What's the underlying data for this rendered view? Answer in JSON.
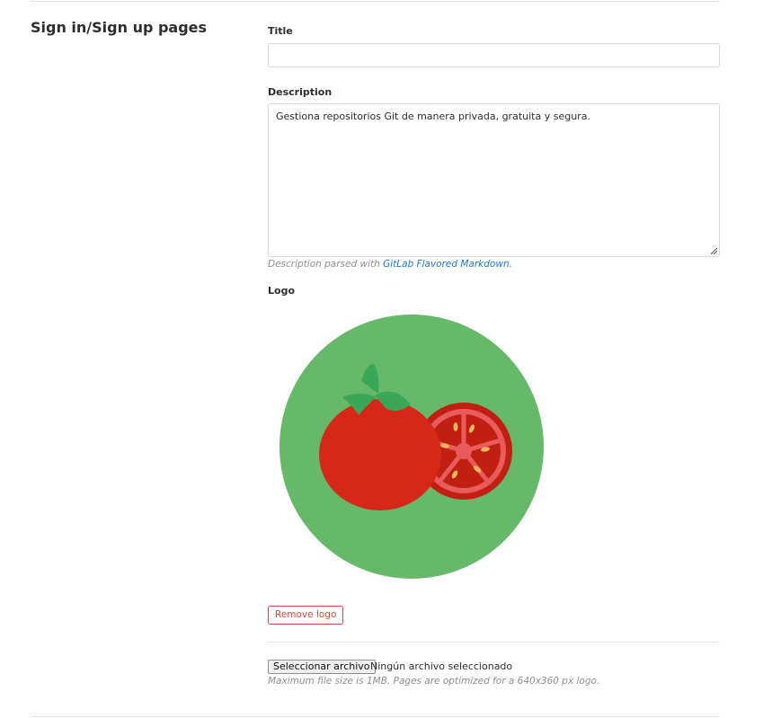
{
  "section": {
    "title": "Sign in/Sign up pages"
  },
  "title_field": {
    "label": "Title",
    "value": ""
  },
  "description_field": {
    "label": "Description",
    "value": "Gestiona repositorios Git de manera privada, gratuita y segura.",
    "help_prefix": "Description parsed with ",
    "help_link": "GitLab Flavored Markdown",
    "help_suffix": "."
  },
  "logo": {
    "label": "Logo",
    "image_icon": "tomato-logo-icon",
    "colors": {
      "circle": "#67b96a",
      "tomato": "#d62718",
      "slice_rim": "#c11f12",
      "slice_flesh": "#e95c5c",
      "stem": "#3aa757",
      "seeds": "#f7b55e"
    },
    "remove_label": "Remove logo"
  },
  "file_input": {
    "button_label": "Seleccionar archivo",
    "status_text": "Ningún archivo seleccionado",
    "help": "Maximum file size is 1MB. Pages are optimized for a 640x360 px logo."
  },
  "colors": {
    "link": "#1f78d1",
    "danger": "#d7473c"
  }
}
